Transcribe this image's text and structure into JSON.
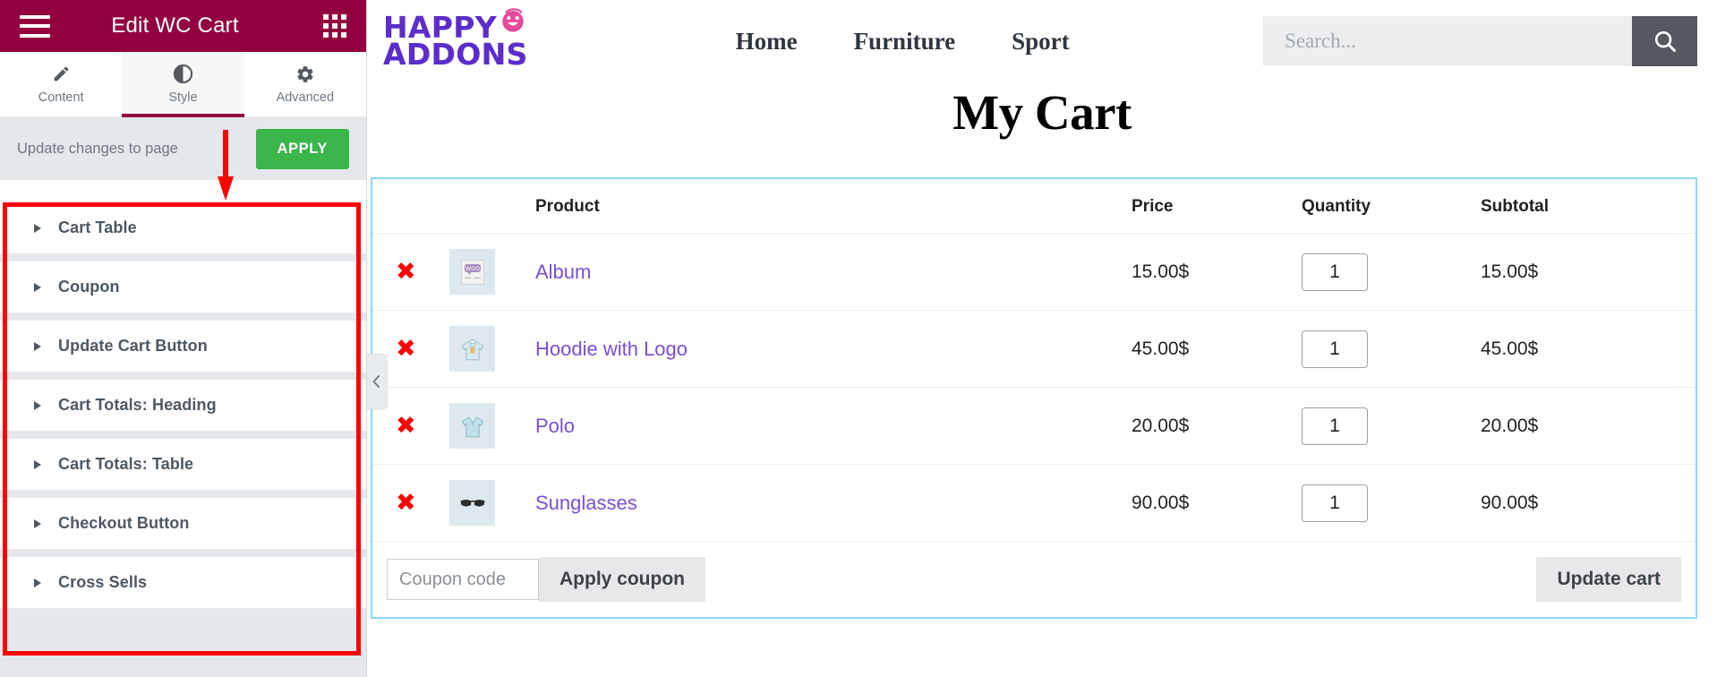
{
  "panel": {
    "title": "Edit WC Cart",
    "menu_icon": "hamburger-icon",
    "apps_icon": "grid-apps-icon",
    "tabs": [
      {
        "label": "Content",
        "icon": "pencil-icon",
        "active": false
      },
      {
        "label": "Style",
        "icon": "contrast-circle-icon",
        "active": true
      },
      {
        "label": "Advanced",
        "icon": "gear-icon",
        "active": false
      }
    ],
    "apply_bar": {
      "text": "Update changes to page",
      "button": "APPLY"
    },
    "sections": [
      {
        "label": "Cart Table"
      },
      {
        "label": "Coupon"
      },
      {
        "label": "Update Cart Button"
      },
      {
        "label": "Cart Totals: Heading"
      },
      {
        "label": "Cart Totals: Table"
      },
      {
        "label": "Checkout Button"
      },
      {
        "label": "Cross Sells"
      }
    ],
    "collapse_icon": "chevron-left-icon",
    "annotation": {
      "arrow_color": "#fe0000",
      "box_color": "#fe0000"
    }
  },
  "site": {
    "logo": {
      "line1": "HAPPY",
      "line2": "ADDONS",
      "face_icon": "happy-face-icon"
    },
    "nav": [
      {
        "label": "Home"
      },
      {
        "label": "Furniture"
      },
      {
        "label": "Sport"
      }
    ],
    "search": {
      "placeholder": "Search...",
      "value": "",
      "button_icon": "search-icon"
    },
    "page_title": "My Cart",
    "cart": {
      "headers": {
        "remove": "",
        "thumb": "",
        "product": "Product",
        "price": "Price",
        "quantity": "Quantity",
        "subtotal": "Subtotal"
      },
      "remove_glyph": "✖",
      "rows": [
        {
          "name": "Album",
          "price": "15.00$",
          "qty": "1",
          "subtotal": "15.00$",
          "thumb_icon": "woo-album-icon"
        },
        {
          "name": "Hoodie with Logo",
          "price": "45.00$",
          "qty": "1",
          "subtotal": "45.00$",
          "thumb_icon": "hoodie-icon"
        },
        {
          "name": "Polo",
          "price": "20.00$",
          "qty": "1",
          "subtotal": "20.00$",
          "thumb_icon": "polo-shirt-icon"
        },
        {
          "name": "Sunglasses",
          "price": "90.00$",
          "qty": "1",
          "subtotal": "90.00$",
          "thumb_icon": "sunglasses-icon"
        }
      ],
      "coupon": {
        "placeholder": "Coupon code",
        "value": "",
        "apply_label": "Apply coupon"
      },
      "update_label": "Update cart"
    }
  },
  "colors": {
    "panel_header": "#93003f",
    "apply_green": "#39b54a",
    "accent_blue": "#8ed6f7",
    "link_purple": "#7a4fd1",
    "annotation_red": "#fe0000",
    "search_btn": "#54595f"
  }
}
